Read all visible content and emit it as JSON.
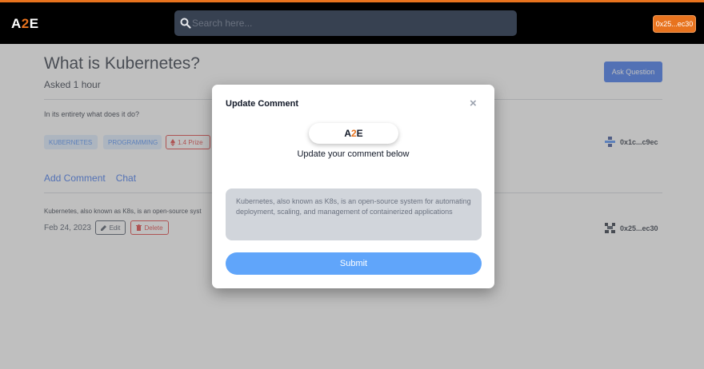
{
  "brand": {
    "logo_a": "A",
    "logo_2": "2",
    "logo_e": "E"
  },
  "search": {
    "placeholder": "Search here..."
  },
  "wallet": {
    "label": "0x25...ec30"
  },
  "question": {
    "title": "What is Kubernetes?",
    "asked": "Asked 1 hour",
    "ask_button": "Ask Question",
    "body": "In its entirety what does it do?",
    "tags": [
      "KUBERNETES",
      "PROGRAMMING"
    ],
    "prize": "1.4 Prize",
    "author": "0x1c...c9ec"
  },
  "actions": {
    "add_comment": "Add Comment",
    "chat": "Chat"
  },
  "comment": {
    "text": "Kubernetes, also known as K8s, is an open-source syst",
    "date": "Feb 24, 2023",
    "edit": "Edit",
    "delete": "Delete",
    "author": "0x25...ec30"
  },
  "modal": {
    "title": "Update Comment",
    "close": "×",
    "subtitle": "Update your comment below",
    "textarea_value": "Kubernetes, also known as K8s, is an open-source system for automating deployment, scaling, and management of containerized applications",
    "submit": "Submit"
  },
  "colors": {
    "accent": "#e8731e",
    "primary": "#2563eb",
    "danger": "#dc2626",
    "submit": "#60a5fa"
  }
}
